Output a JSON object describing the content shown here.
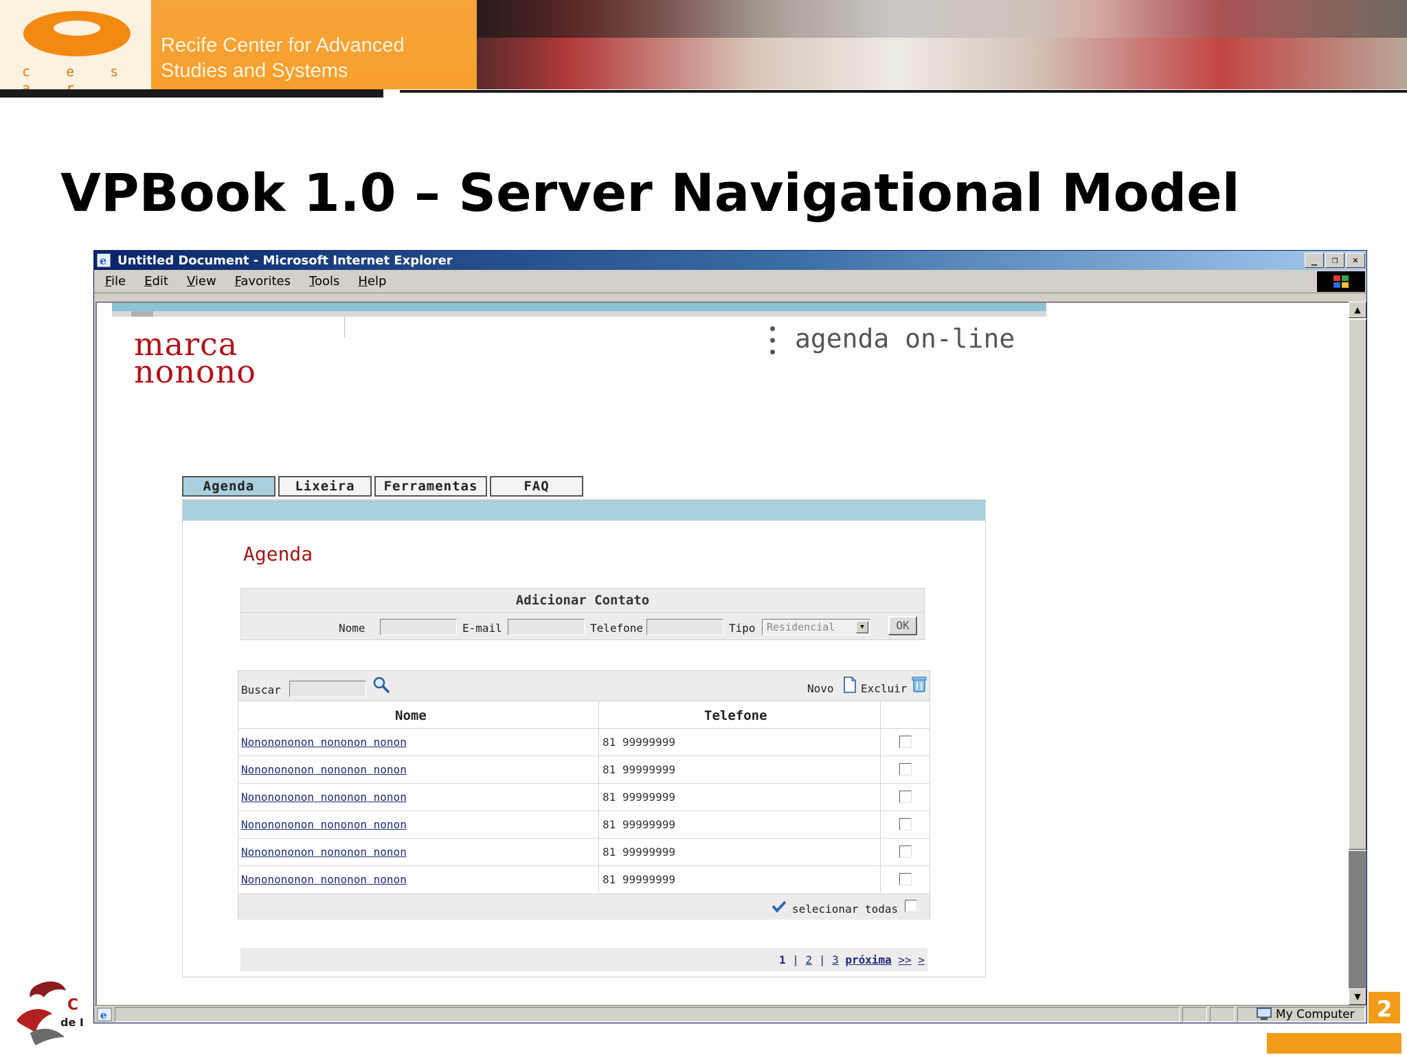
{
  "banner": {
    "logo_letters": "c e s a r",
    "text_line1": "Recife Center for Advanced",
    "text_line2": "Studies and Systems"
  },
  "slide": {
    "title": "VPBook 1.0 – Server Navigational Model"
  },
  "browser": {
    "window_title": "Untitled Document - Microsoft Internet Explorer",
    "menu": [
      {
        "underline": "F",
        "rest": "ile"
      },
      {
        "underline": "E",
        "rest": "dit"
      },
      {
        "underline": "V",
        "rest": "iew"
      },
      {
        "underline": "F",
        "rest": "avorites",
        "pre": ""
      },
      {
        "underline": "T",
        "rest": "ools"
      },
      {
        "underline": "H",
        "rest": "elp"
      }
    ],
    "status_zone": "My Computer"
  },
  "page": {
    "brand_line1": "marca",
    "brand_line2": "nonono",
    "app_title": "agenda on-line",
    "tabs": [
      {
        "label": "Agenda",
        "active": true
      },
      {
        "label": "Lixeira",
        "active": false
      },
      {
        "label": "Ferramentas",
        "active": false
      },
      {
        "label": "FAQ",
        "active": false
      }
    ],
    "section_title": "Agenda",
    "add_contact": {
      "title": "Adicionar Contato",
      "name_label": "Nome",
      "email_label": "E-mail",
      "phone_label": "Telefone",
      "type_label": "Tipo",
      "type_value": "Residencial",
      "ok_label": "OK"
    },
    "list": {
      "search_label": "Buscar",
      "new_label": "Novo",
      "delete_label": "Excluir",
      "col_name": "Nome",
      "col_phone": "Telefone",
      "rows": [
        {
          "name": "Nononononon nononon nonon",
          "phone": "81 99999999"
        },
        {
          "name": "Nononononon nononon nonon",
          "phone": "81 99999999"
        },
        {
          "name": "Nononononon nononon nonon",
          "phone": "81 99999999"
        },
        {
          "name": "Nononononon nononon nonon",
          "phone": "81 99999999"
        },
        {
          "name": "Nononononon nononon nonon",
          "phone": "81 99999999"
        },
        {
          "name": "Nononononon nononon nonon",
          "phone": "81 99999999"
        }
      ],
      "select_all_label": "selecionar todas"
    },
    "pager": {
      "p1": "1",
      "p2": "2",
      "p3": "3",
      "next": "próxima",
      "last1": ">>",
      "last2": ">"
    }
  },
  "colors": {
    "accent_orange": "#f7a02c",
    "brand_red": "#b3121b",
    "tab_blue": "#aacfdd",
    "link_blue": "#1c2a7a"
  }
}
